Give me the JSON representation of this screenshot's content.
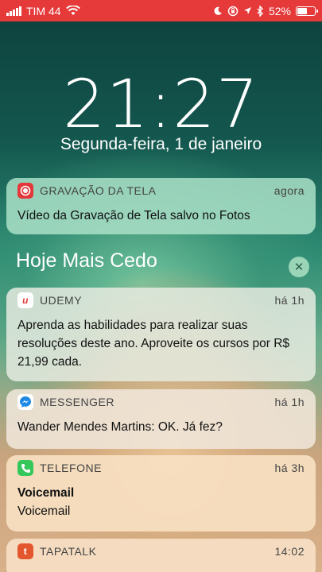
{
  "status_bar": {
    "carrier": "TIM 44",
    "battery": "52%",
    "battery_level": 0.52,
    "icons": [
      "signal-bars-icon",
      "wifi-icon",
      "moon-icon",
      "orientation-lock-icon",
      "location-arrow-icon",
      "bluetooth-icon",
      "battery-icon"
    ]
  },
  "lock": {
    "time": "21:27",
    "date": "Segunda-feira, 1 de janeiro"
  },
  "section": {
    "title": "Hoje Mais Cedo",
    "clear_icon": "close-icon"
  },
  "notifications": [
    {
      "app": "GRAVAÇÃO DA TELA",
      "time": "agora",
      "body": "Vídeo da Gravação de Tela salvo no Fotos",
      "icon": "screen-recording-icon",
      "icon_color": "#e4373a"
    },
    {
      "app": "UDEMY",
      "time": "há 1h",
      "body": "Aprenda as habilidades para realizar suas resoluções deste ano. Aproveite os cursos por R$ 21,99 cada.",
      "icon": "udemy-icon",
      "icon_color": "#e23b3b"
    },
    {
      "app": "MESSENGER",
      "time": "há 1h",
      "body": "Wander Mendes Martins:  OK. Já fez?",
      "icon": "messenger-icon",
      "icon_color": "#1e88e5"
    },
    {
      "app": "TELEFONE",
      "time": "há 3h",
      "title": "Voicemail",
      "body": "Voicemail",
      "icon": "phone-icon",
      "icon_color": "#35c759"
    },
    {
      "app": "TAPATALK",
      "time": "14:02",
      "icon": "tapatalk-icon",
      "icon_color": "#e4572e"
    }
  ]
}
